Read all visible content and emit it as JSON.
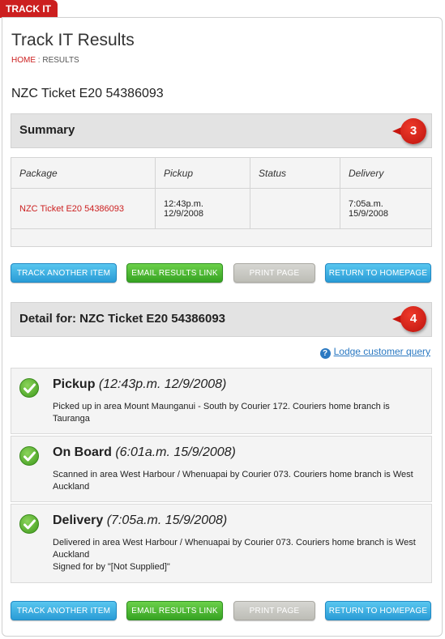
{
  "tab_label": "TRACK IT",
  "page_title": "Track IT Results",
  "breadcrumb": {
    "home": "HOME",
    "sep": " : ",
    "current": "RESULTS"
  },
  "ticket_heading": "NZC Ticket E20 54386093",
  "summary": {
    "heading": "Summary",
    "marker": "3",
    "columns": [
      "Package",
      "Pickup",
      "Status",
      "Delivery"
    ],
    "row": {
      "package": "NZC Ticket E20 54386093",
      "pickup_time": "12:43p.m.",
      "pickup_date": "12/9/2008",
      "status": "",
      "delivery_time": "7:05a.m.",
      "delivery_date": "15/9/2008"
    }
  },
  "buttons": {
    "track_another": "TRACK ANOTHER ITEM",
    "email_results": "EMAIL RESULTS LINK",
    "print_page": "PRINT PAGE",
    "return_home": "RETURN TO HOMEPAGE"
  },
  "detail": {
    "heading": "Detail for: NZC Ticket E20 54386093",
    "marker": "4",
    "lodge_query": "Lodge customer query",
    "events": [
      {
        "title": "Pickup",
        "time": "(12:43p.m. 12/9/2008)",
        "desc": "Picked up in area Mount Maunganui - South by Courier 172. Couriers home branch is Tauranga"
      },
      {
        "title": "On Board",
        "time": "(6:01a.m. 15/9/2008)",
        "desc": "Scanned in area West Harbour / Whenuapai by Courier 073. Couriers home branch is West Auckland"
      },
      {
        "title": "Delivery",
        "time": "(7:05a.m. 15/9/2008)",
        "desc": "Delivered in area West Harbour / Whenuapai by Courier 073. Couriers home branch is West Auckland",
        "signed": "Signed for by \"[Not Supplied]\""
      }
    ]
  },
  "colors": {
    "brand_red": "#cc1f1f",
    "link_blue": "#2b79c2",
    "button_blue": "#2a9cd6",
    "button_green": "#36a322",
    "button_grey": "#bdbdb6"
  }
}
